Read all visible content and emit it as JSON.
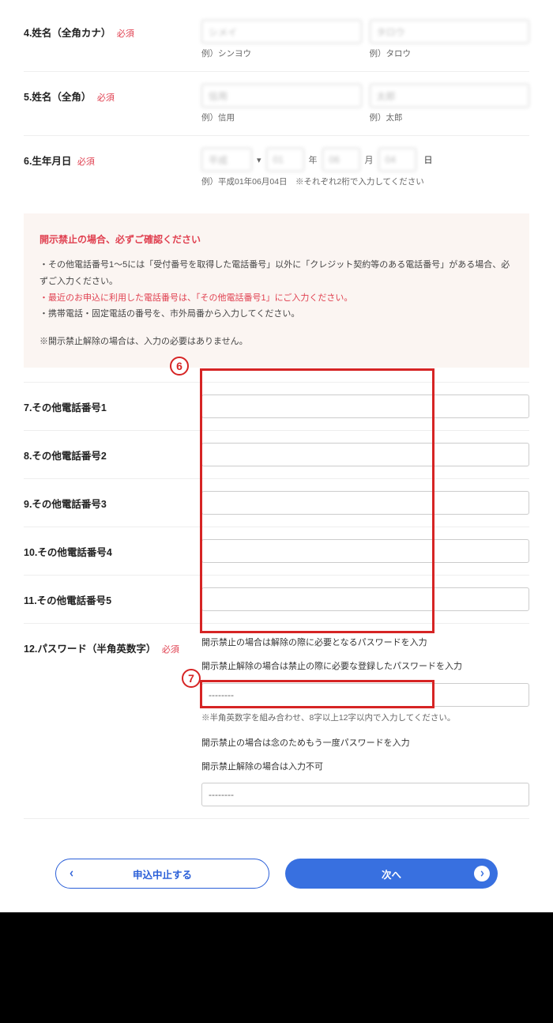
{
  "fields": {
    "kana": {
      "label": "4.姓名（全角カナ）",
      "required": "必須",
      "last_value": "シメイ",
      "first_value": "タロウ",
      "hint_last": "例）シンヨウ",
      "hint_first": "例）タロウ"
    },
    "name": {
      "label": "5.姓名（全角）",
      "required": "必須",
      "last_value": "信用",
      "first_value": "太郎",
      "hint_last": "例）信用",
      "hint_first": "例）太郎"
    },
    "dob": {
      "label": "6.生年月日",
      "required": "必須",
      "era": "平成",
      "y": "01",
      "m": "06",
      "d": "04",
      "unit": "日",
      "hint": "例）平成01年06月04日　※それぞれ2桁で入力してください"
    },
    "phones": {
      "p1": "7.その他電話番号1",
      "p2": "8.その他電話番号2",
      "p3": "9.その他電話番号3",
      "p4": "10.その他電話番号4",
      "p5": "11.その他電話番号5"
    },
    "password": {
      "label": "12.パスワード（半角英数字）",
      "required": "必須",
      "desc1": "開示禁止の場合は解除の際に必要となるパスワードを入力",
      "desc2": "開示禁止解除の場合は禁止の際に必要な登録したパスワードを入力",
      "value1": "--------",
      "hint": "※半角英数字を組み合わせ、8字以上12字以内で入力してください。",
      "desc3": "開示禁止の場合は念のためもう一度パスワードを入力",
      "desc4": "開示禁止解除の場合は入力不可",
      "value2": "--------"
    }
  },
  "notice": {
    "title": "開示禁止の場合、必ずご確認ください",
    "line1a": "・その他電話番号1～5には「受付番号を取得した電話番号」以外に",
    "line1b": "「クレジット契約等のある電話番号」がある場合、必ずご入力ください。",
    "line2": "・最近のお申込に利用した電話番号は、「その他電話番号1」にご入力ください。",
    "line3": "・携帯電話・固定電話の番号を、市外局番から入力してください。",
    "line4": "※開示禁止解除の場合は、入力の必要はありません。"
  },
  "buttons": {
    "cancel": "申込中止する",
    "next": "次へ"
  },
  "markers": {
    "m6": "6",
    "m7": "7"
  }
}
